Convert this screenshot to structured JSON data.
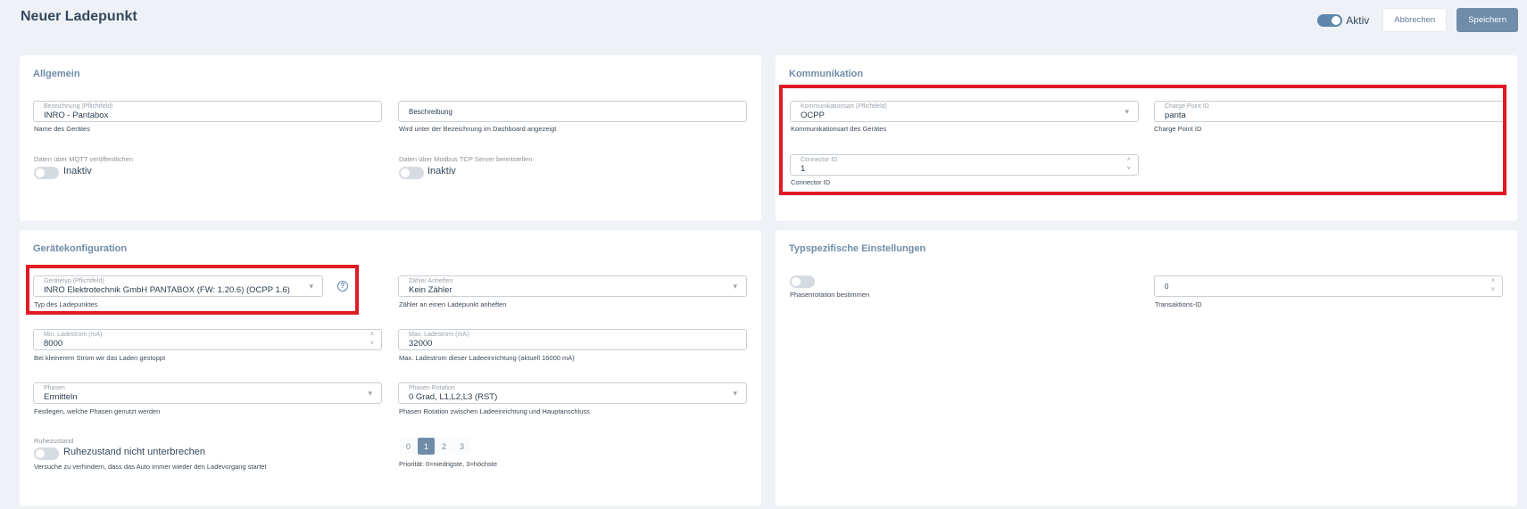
{
  "header": {
    "title": "Neuer Ladepunkt",
    "active_label": "Aktiv",
    "cancel_label": "Abbrechen",
    "save_label": "Speichern"
  },
  "allgemein": {
    "title": "Allgemein",
    "name": {
      "label": "Bezeichnung (Pflichtfeld)",
      "value": "INRO - Pantabox",
      "hint": "Name des Gerätes"
    },
    "description": {
      "placeholder": "Beschreibung",
      "hint": "Wird unter der Bezeichnung im Dashboard angezeigt"
    },
    "mqtt": {
      "label": "Daten über MQTT veröffentlichen",
      "state": "Inaktiv"
    },
    "modbus": {
      "label": "Daten über Modbus TCP Server bereitstellen",
      "state": "Inaktiv"
    }
  },
  "kommunikation": {
    "title": "Kommunikation",
    "type": {
      "label": "Kommunikationsart (Pflichtfeld)",
      "value": "OCPP",
      "hint": "Kommunikationsart des Gerätes"
    },
    "charge_point_id": {
      "label": "Charge Point ID",
      "value": "panta",
      "hint": "Charge Point ID"
    },
    "connector_id": {
      "label": "Connector ID",
      "value": "1",
      "hint": "Connector ID"
    }
  },
  "geraetekonfiguration": {
    "title": "Gerätekonfiguration",
    "device_type": {
      "label": "Gerätetyp (Pflichtfeld)",
      "value": "INRO Elektrotechnik GmbH PANTABOX (FW: 1.20.6) (OCPP 1.6)",
      "hint": "Typ des Ladepunktes"
    },
    "meter": {
      "label": "Zähler Anheften",
      "value": "Kein Zähler",
      "hint": "Zähler an einen Ladepunkt anheften"
    },
    "min_current": {
      "label": "Min. Ladestrom (mA)",
      "value": "8000",
      "hint": "Bei kleinerem Strom wir das Laden gestoppt"
    },
    "max_current": {
      "label": "Max. Ladestrom (mA)",
      "value": "32000",
      "hint": "Max. Ladestrom dieser Ladeeinrichtung (aktuell 16000 mA)"
    },
    "phases": {
      "label": "Phasen",
      "value": "Ermitteln",
      "hint": "Festlegen, welche Phasen genutzt werden"
    },
    "phase_rotation": {
      "label": "Phasen Rotation",
      "value": "0 Grad, L1,L2,L3 (RST)",
      "hint": "Phasen Rotation zwischen Ladeeinrichtung und Hauptanschluss"
    },
    "idle": {
      "label": "Ruhezustand",
      "state": "Ruhezustand nicht unterbrechen",
      "hint": "Versuche zu verhindern, dass das Auto immer wieder den Ladevorgang startet"
    },
    "priority": {
      "options": [
        "0",
        "1",
        "2",
        "3"
      ],
      "selected": "1",
      "hint": "Priorität: 0=niedrigste, 3=höchste"
    }
  },
  "typspezifisch": {
    "title": "Typspezifische Einstellungen",
    "phase_rotation_toggle_label": "Phasenrotation bestimmen",
    "transaction_id": {
      "value": "0",
      "hint": "Transaktions-ID"
    }
  },
  "icons": {
    "chevron": "▾",
    "spin_up": "˄",
    "spin_down": "˅",
    "help": "?"
  },
  "colors": {
    "accent": "#6f8ca8",
    "highlight": "#e01b24"
  }
}
